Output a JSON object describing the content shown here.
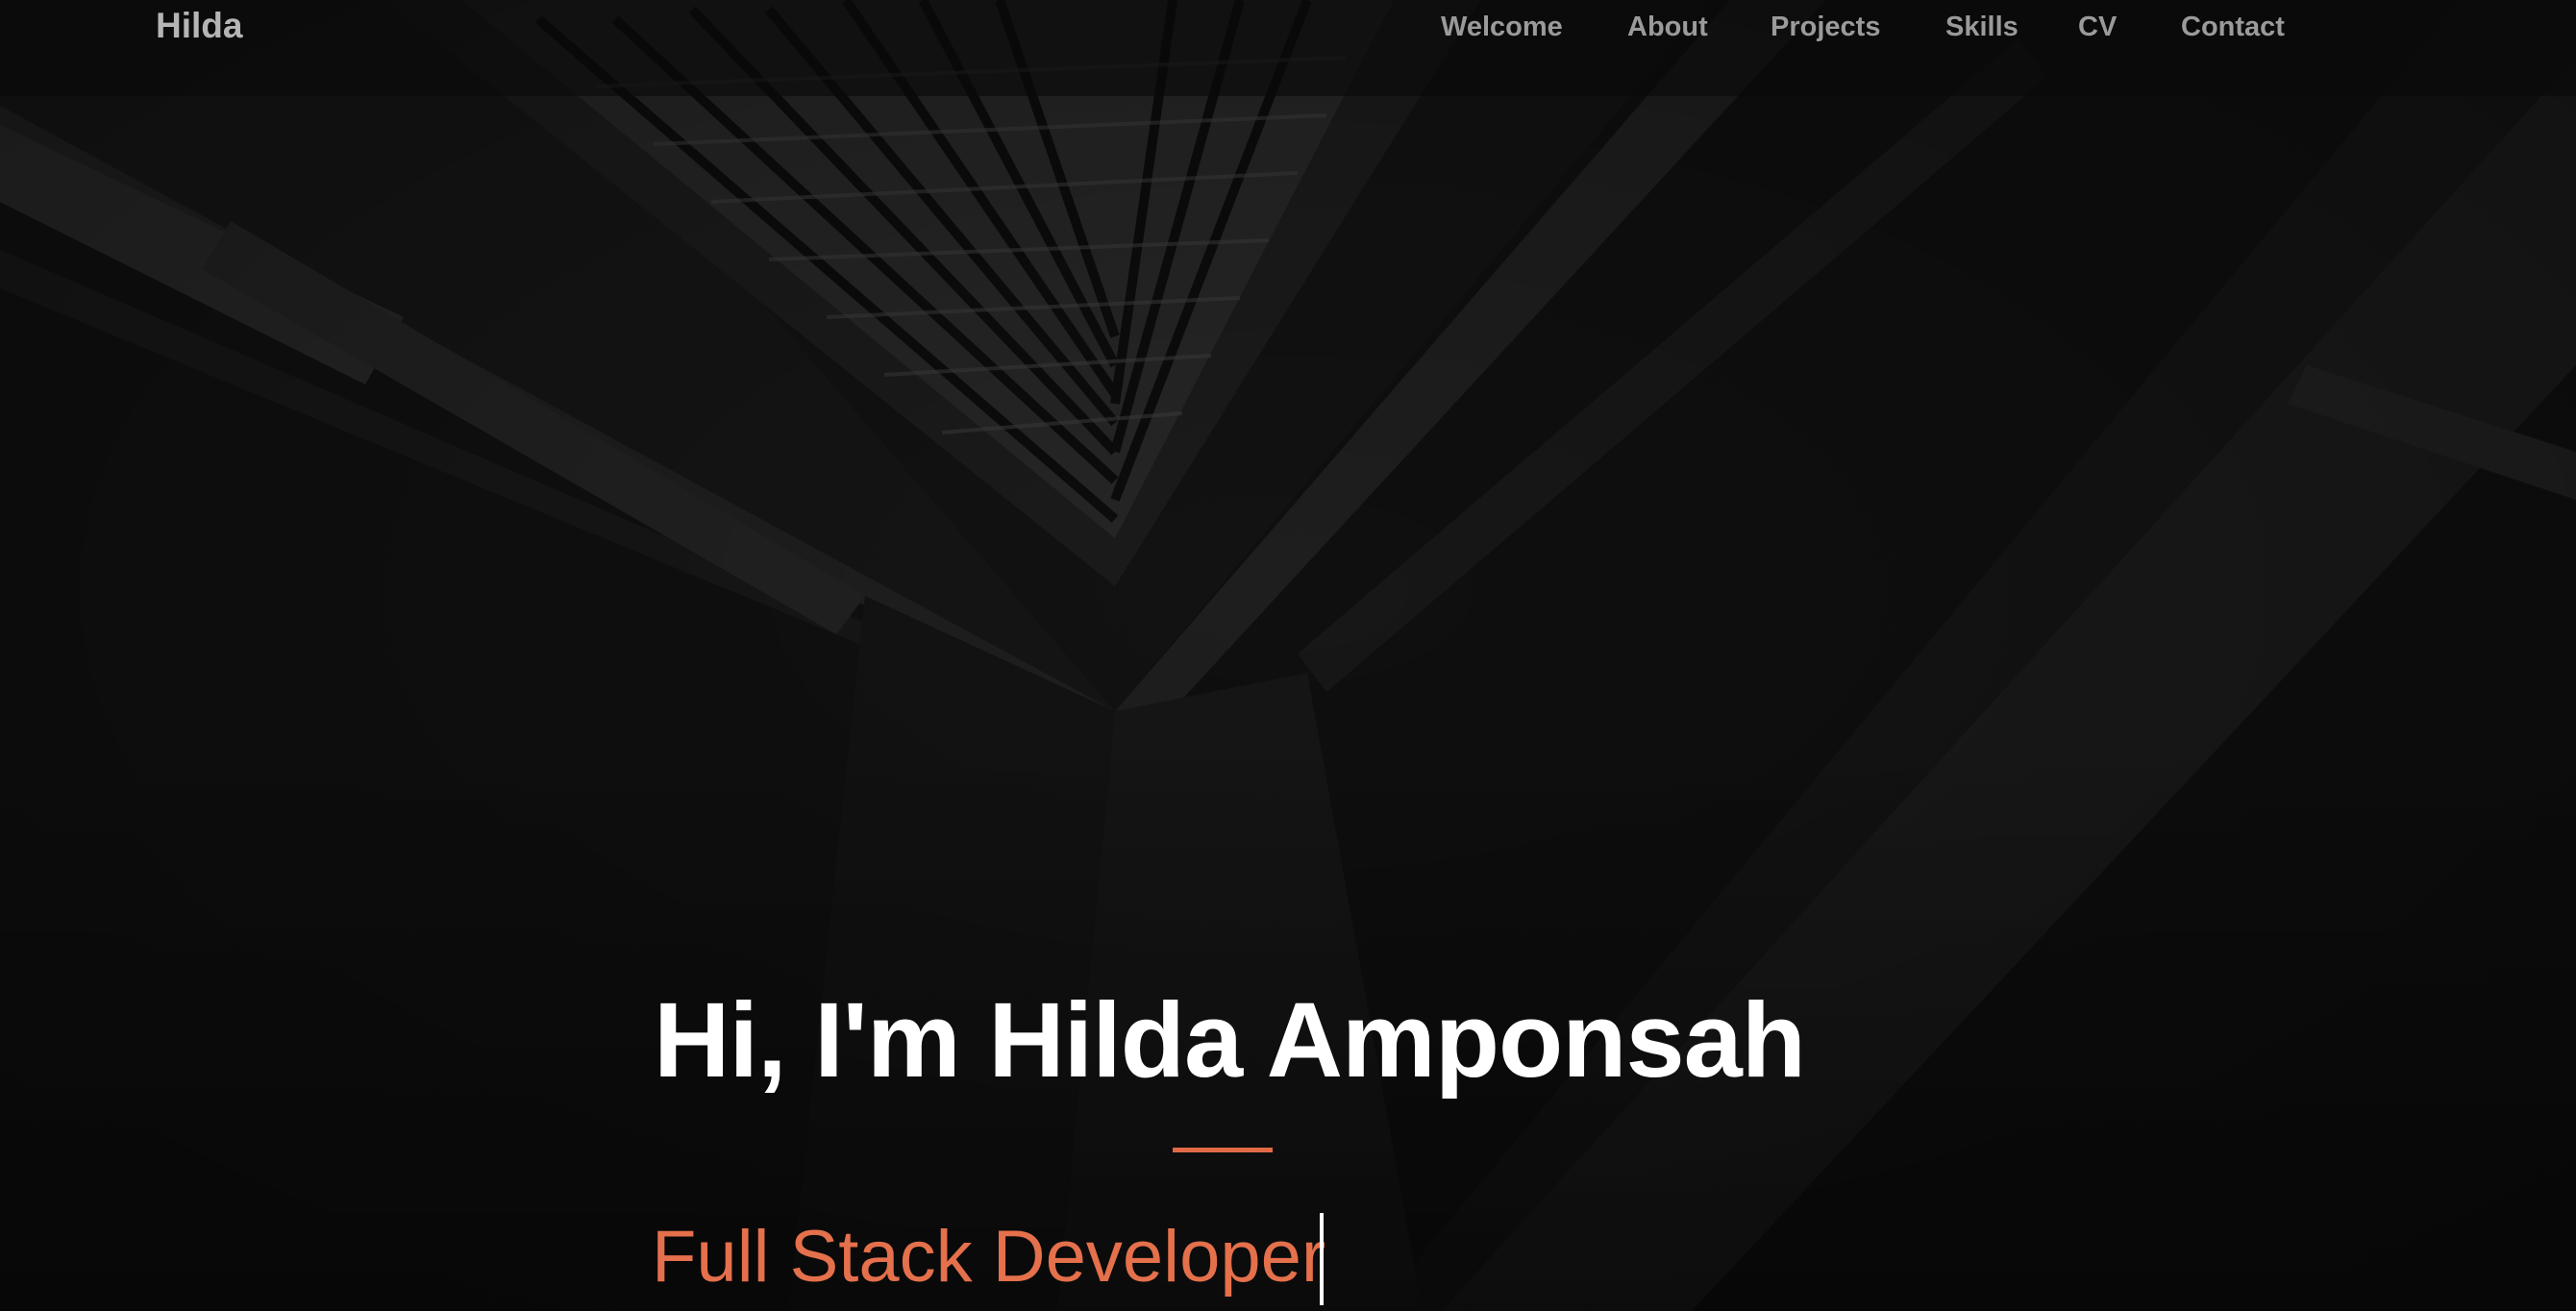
{
  "navbar": {
    "brand": "Hilda",
    "links": [
      {
        "label": "Welcome"
      },
      {
        "label": "About"
      },
      {
        "label": "Projects"
      },
      {
        "label": "Skills"
      },
      {
        "label": "CV"
      },
      {
        "label": "Contact"
      }
    ]
  },
  "hero": {
    "title": "Hi, I'm Hilda Amponsah",
    "subtitle": "Full Stack Developer"
  },
  "colors": {
    "accent": "#e16a46",
    "nav_text": "#9a9a9a",
    "background": "#0e0e0e"
  }
}
